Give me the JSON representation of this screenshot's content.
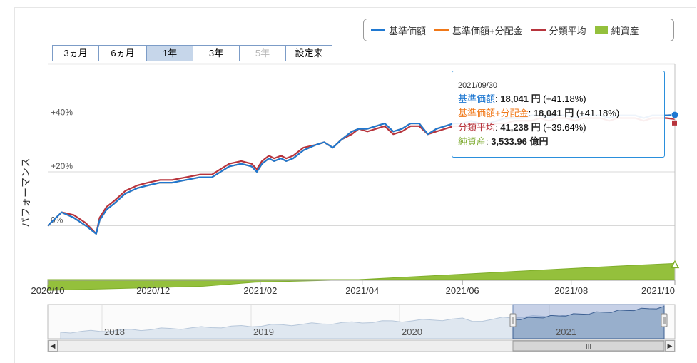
{
  "legend": [
    {
      "label": "基準価額",
      "color": "#1f78d1",
      "type": "line"
    },
    {
      "label": "基準価額+分配金",
      "color": "#f07818",
      "type": "line"
    },
    {
      "label": "分類平均",
      "color": "#b7343c",
      "type": "line"
    },
    {
      "label": "純資産",
      "color": "#94c03c",
      "type": "box"
    }
  ],
  "range_buttons": [
    {
      "label": "3ヵ月",
      "state": "normal"
    },
    {
      "label": "6ヵ月",
      "state": "normal"
    },
    {
      "label": "1年",
      "state": "selected"
    },
    {
      "label": "3年",
      "state": "normal"
    },
    {
      "label": "5年",
      "state": "disabled"
    },
    {
      "label": "設定来",
      "state": "normal"
    }
  ],
  "tooltip": {
    "date": "2021/09/30",
    "nav_label": "基準価額",
    "nav_value": "18,041 円",
    "nav_change": "(+41.18%)",
    "navdist_label": "基準価額+分配金",
    "navdist_value": "18,041 円",
    "navdist_change": "(+41.18%)",
    "avg_label": "分類平均",
    "avg_value": "41,238 円",
    "avg_change": "(+39.64%)",
    "assets_label": "純資産",
    "assets_value": "3,533.96 億円"
  },
  "chart_data": {
    "type": "line",
    "ylabel": "パフォーマンス",
    "y_ticks": [
      "0%",
      "+20%",
      "+40%"
    ],
    "ylim": [
      -20,
      60
    ],
    "x_ticks": [
      "2020/10",
      "2020/12",
      "2021/02",
      "2021/04",
      "2021/06",
      "2021/08",
      "2021/10"
    ],
    "x_tick_pos": [
      0,
      61,
      123,
      182,
      240,
      303,
      363
    ],
    "x_range": [
      0,
      363
    ],
    "grid": true,
    "legend_position": "top-right",
    "series": [
      {
        "name": "基準価額",
        "color": "#1f78d1",
        "x": [
          0,
          8,
          15,
          22,
          28,
          30,
          34,
          38,
          45,
          52,
          58,
          65,
          72,
          80,
          88,
          95,
          100,
          105,
          112,
          118,
          121,
          124,
          128,
          131,
          135,
          138,
          142,
          148,
          155,
          160,
          165,
          170,
          176,
          180,
          185,
          190,
          195,
          200,
          205,
          210,
          215,
          220,
          225,
          230,
          235,
          240,
          245,
          250,
          255,
          260,
          265,
          270,
          275,
          280,
          285,
          290,
          295,
          300,
          305,
          310,
          315,
          320,
          325,
          330,
          335,
          340,
          345,
          350,
          355,
          358,
          363
        ],
        "y": [
          0,
          5,
          3,
          0,
          -3,
          2,
          6,
          8,
          12,
          14,
          15,
          16,
          16,
          17,
          18,
          18,
          20,
          22,
          23,
          22,
          20,
          23,
          25,
          24,
          25,
          24,
          25,
          28,
          30,
          31,
          29,
          32,
          35,
          36,
          36,
          37,
          38,
          35,
          36,
          38,
          38,
          34,
          36,
          37,
          38,
          38,
          39,
          38,
          38,
          39,
          40,
          40,
          40,
          41,
          41,
          40,
          41,
          41,
          40,
          41,
          41,
          41,
          40,
          41,
          41,
          41,
          40,
          41,
          41,
          41,
          41.18
        ]
      },
      {
        "name": "基準価額+分配金",
        "color": "#f07818",
        "x": [
          0,
          8,
          15,
          22,
          28,
          30,
          34,
          38,
          45,
          52,
          58,
          65,
          72,
          80,
          88,
          95,
          100,
          105,
          112,
          118,
          121,
          124,
          128,
          131,
          135,
          138,
          142,
          148,
          155,
          160,
          165,
          170,
          176,
          180,
          185,
          190,
          195,
          200,
          205,
          210,
          215,
          220,
          225,
          230,
          235,
          240,
          245,
          250,
          255,
          260,
          265,
          270,
          275,
          280,
          285,
          290,
          295,
          300,
          305,
          310,
          315,
          320,
          325,
          330,
          335,
          340,
          345,
          350,
          355,
          358,
          363
        ],
        "y": [
          0,
          5,
          3,
          0,
          -3,
          2,
          6,
          8,
          12,
          14,
          15,
          16,
          16,
          17,
          18,
          18,
          20,
          22,
          23,
          22,
          20,
          23,
          25,
          24,
          25,
          24,
          25,
          28,
          30,
          31,
          29,
          32,
          35,
          36,
          36,
          37,
          38,
          35,
          36,
          38,
          38,
          34,
          36,
          37,
          38,
          38,
          39,
          38,
          38,
          39,
          40,
          40,
          40,
          41,
          41,
          40,
          41,
          41,
          40,
          41,
          41,
          41,
          40,
          41,
          41,
          41,
          40,
          41,
          41,
          41,
          41.18
        ]
      },
      {
        "name": "分類平均",
        "color": "#b7343c",
        "x": [
          0,
          8,
          15,
          22,
          28,
          30,
          34,
          38,
          45,
          52,
          58,
          65,
          72,
          80,
          88,
          95,
          100,
          105,
          112,
          118,
          121,
          124,
          128,
          131,
          135,
          138,
          142,
          148,
          155,
          160,
          165,
          170,
          176,
          180,
          185,
          190,
          195,
          200,
          205,
          210,
          215,
          220,
          225,
          230,
          235,
          240,
          245,
          250,
          255,
          260,
          265,
          270,
          275,
          280,
          285,
          290,
          295,
          300,
          305,
          310,
          315,
          320,
          325,
          330,
          335,
          340,
          345,
          350,
          355,
          358,
          363
        ],
        "y": [
          0,
          5,
          4,
          1,
          -3,
          3,
          7,
          9,
          13,
          15,
          16,
          17,
          17,
          18,
          19,
          19,
          21,
          23,
          24,
          23,
          21,
          24,
          26,
          25,
          26,
          25,
          26,
          29,
          30,
          31,
          29,
          32,
          34,
          36,
          35,
          36,
          37,
          34,
          35,
          37,
          37,
          34,
          35,
          36,
          37,
          37,
          38,
          37,
          37,
          38,
          38,
          39,
          39,
          39,
          40,
          39,
          40,
          40,
          39,
          40,
          40,
          40,
          39,
          40,
          40,
          40,
          39,
          40,
          40,
          40,
          39.64
        ]
      },
      {
        "name": "純資産",
        "color": "#94c03c",
        "kind": "area",
        "x": [
          0,
          30,
          60,
          90,
          120,
          150,
          180,
          210,
          240,
          270,
          300,
          330,
          363
        ],
        "y": [
          -24,
          -23.5,
          -23,
          -22.5,
          -21,
          -20.5,
          -20,
          -19,
          -18,
          -17,
          -16,
          -15,
          -14
        ]
      }
    ]
  },
  "navigator": {
    "years": [
      "2018",
      "2019",
      "2020",
      "2021"
    ],
    "scrollbar_grip": "III"
  }
}
